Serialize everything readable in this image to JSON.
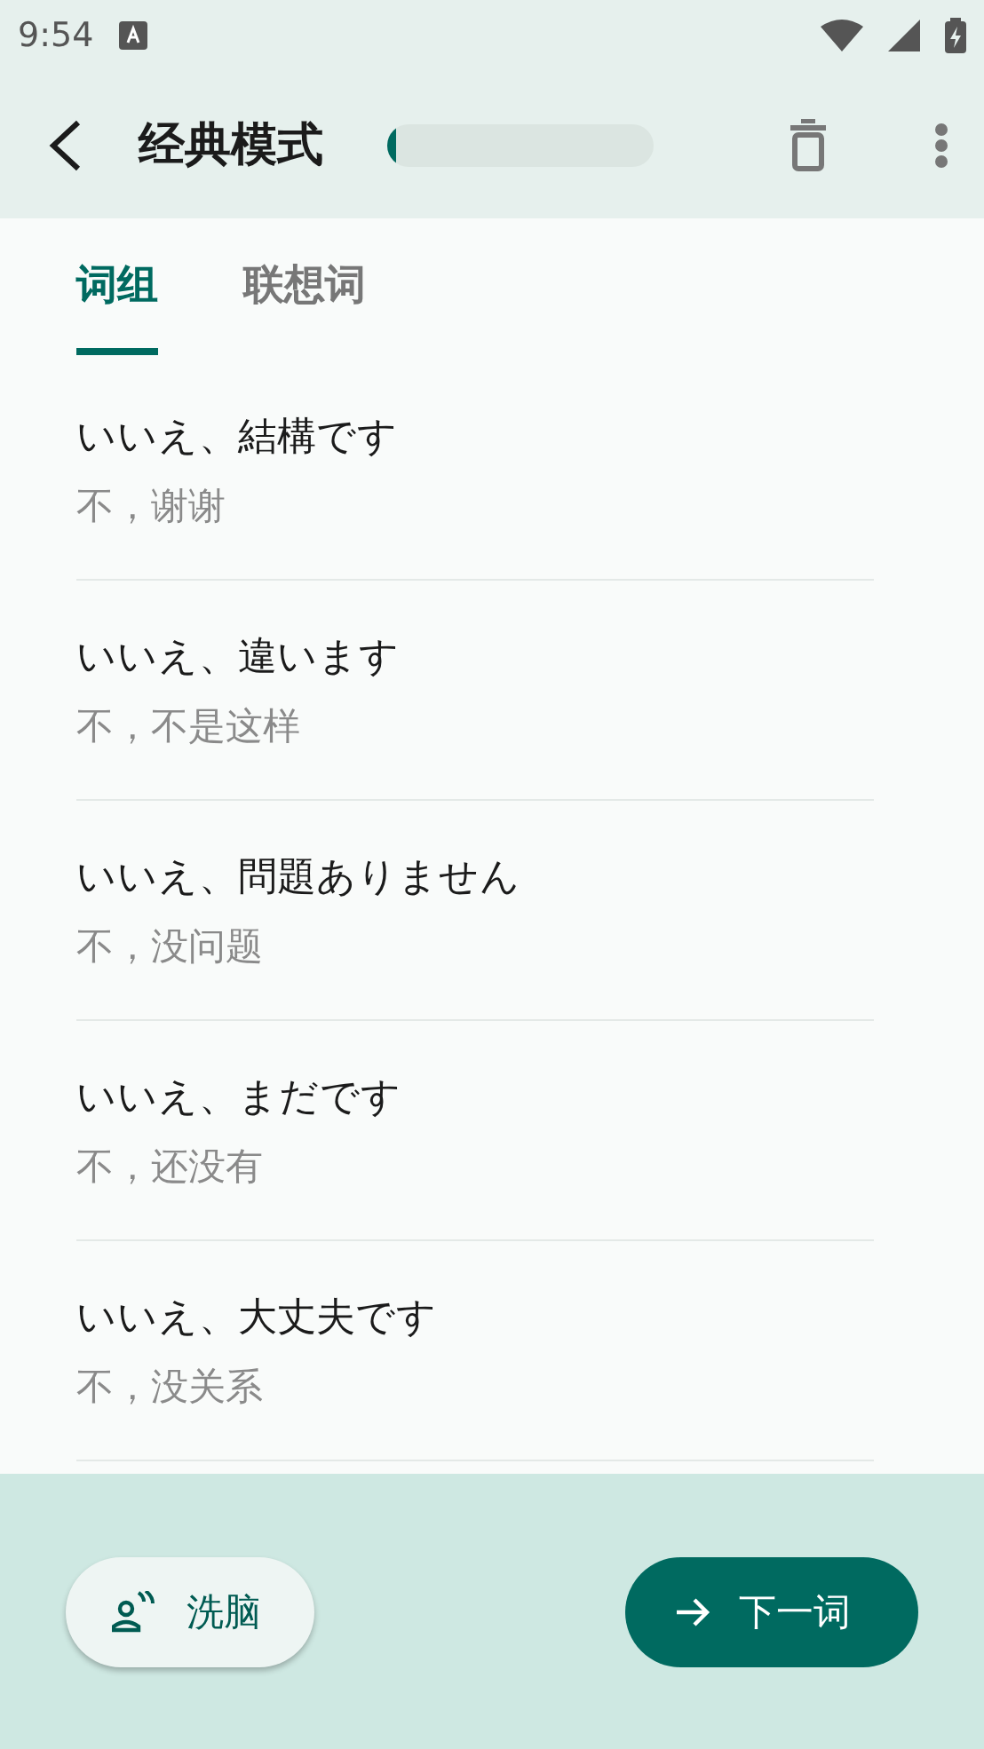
{
  "status_bar": {
    "time": "9:54"
  },
  "app_bar": {
    "title": "经典模式",
    "progress": {
      "level": 0.03
    }
  },
  "tabs": [
    {
      "label": "词组",
      "selected": true
    },
    {
      "label": "联想词",
      "selected": false
    }
  ],
  "items": [
    {
      "phrase": "いいえ、結構です",
      "meaning": "不，谢谢"
    },
    {
      "phrase": "いいえ、違います",
      "meaning": "不，不是这样"
    },
    {
      "phrase": "いいえ、問題ありません",
      "meaning": "不，没问题"
    },
    {
      "phrase": "いいえ、まだです",
      "meaning": "不，还没有"
    },
    {
      "phrase": "いいえ、大丈夫です",
      "meaning": "不，没关系"
    }
  ],
  "actions": [
    {
      "label": "洗脑",
      "kind": "secondary"
    },
    {
      "label": "下一词",
      "kind": "primary"
    }
  ]
}
